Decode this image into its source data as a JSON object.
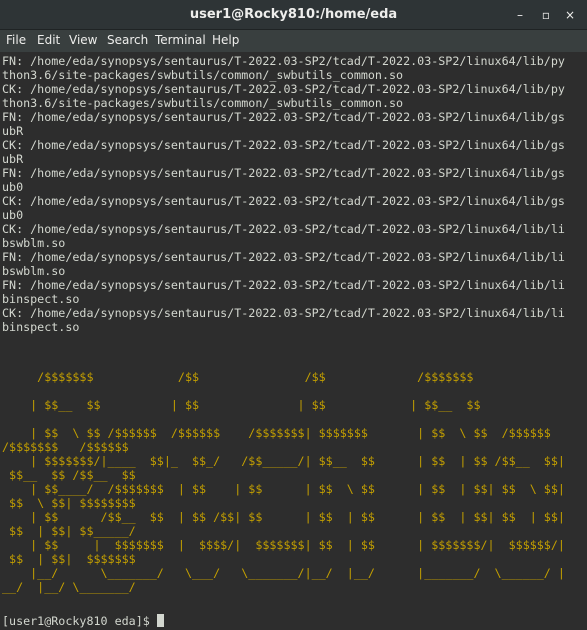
{
  "window": {
    "title": "user1@Rocky810:/home/eda",
    "controls": {
      "minimize": "–",
      "maximize": "▫",
      "close": "×"
    }
  },
  "menubar": {
    "items": [
      "File",
      "Edit",
      "View",
      "Search",
      "Terminal",
      "Help"
    ]
  },
  "terminal": {
    "output_lines": [
      "FN: /home/eda/synopsys/sentaurus/T-2022.03-SP2/tcad/T-2022.03-SP2/linux64/lib/py",
      "thon3.6/site-packages/swbutils/common/_swbutils_common.so",
      "CK: /home/eda/synopsys/sentaurus/T-2022.03-SP2/tcad/T-2022.03-SP2/linux64/lib/py",
      "thon3.6/site-packages/swbutils/common/_swbutils_common.so",
      "FN: /home/eda/synopsys/sentaurus/T-2022.03-SP2/tcad/T-2022.03-SP2/linux64/lib/gs",
      "ubR",
      "CK: /home/eda/synopsys/sentaurus/T-2022.03-SP2/tcad/T-2022.03-SP2/linux64/lib/gs",
      "ubR",
      "FN: /home/eda/synopsys/sentaurus/T-2022.03-SP2/tcad/T-2022.03-SP2/linux64/lib/gs",
      "ub0",
      "CK: /home/eda/synopsys/sentaurus/T-2022.03-SP2/tcad/T-2022.03-SP2/linux64/lib/gs",
      "ub0",
      "CK: /home/eda/synopsys/sentaurus/T-2022.03-SP2/tcad/T-2022.03-SP2/linux64/lib/li",
      "bswblm.so",
      "FN: /home/eda/synopsys/sentaurus/T-2022.03-SP2/tcad/T-2022.03-SP2/linux64/lib/li",
      "bswblm.so",
      "FN: /home/eda/synopsys/sentaurus/T-2022.03-SP2/tcad/T-2022.03-SP2/linux64/lib/li",
      "binspect.so",
      "CK: /home/eda/synopsys/sentaurus/T-2022.03-SP2/tcad/T-2022.03-SP2/linux64/lib/li",
      "binspect.so"
    ],
    "banner_lines": [
      "     /$$$$$$$            /$$               /$$             /$$$$$$$",
      "    | $$__  $$          | $$              | $$            | $$__  $$",
      "    | $$  \\ $$ /$$$$$$  /$$$$$$    /$$$$$$$| $$$$$$$       | $$  \\ $$  /$$$$$$",
      "/$$$$$$$   /$$$$$$",
      "    | $$$$$$$/|____  $$|_  $$_/   /$$_____/| $$__  $$      | $$  | $$ /$$__  $$|",
      " $$__  $$ /$$__  $$",
      "    | $$____/  /$$$$$$$  | $$    | $$      | $$  \\ $$      | $$  | $$| $$  \\ $$|",
      " $$  \\ $$| $$$$$$$$",
      "    | $$      /$$__  $$  | $$ /$$| $$      | $$  | $$      | $$  | $$| $$  | $$|",
      " $$  | $$| $$_____/",
      "    | $$     |  $$$$$$$  |  $$$$/|  $$$$$$$| $$  | $$      | $$$$$$$/|  $$$$$$/|",
      " $$  | $$|  $$$$$$$",
      "    |__/      \\_______/   \\___/   \\_______/|__/  |__/      |_______/  \\______/ |",
      "__/  |__/ \\_______/"
    ],
    "prompt": "[user1@Rocky810 eda]$ "
  },
  "colors": {
    "background": "#2d2d2d",
    "text": "#d3d7cf",
    "banner": "#c4a000",
    "titlebar": "#2e3436",
    "menubar": "#393f3f"
  }
}
